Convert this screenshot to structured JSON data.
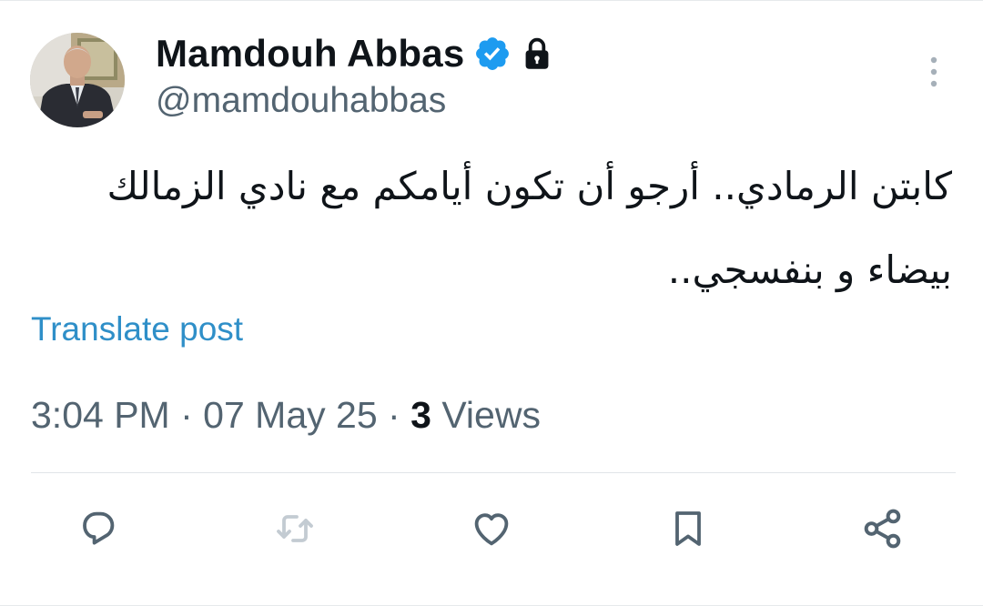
{
  "author": {
    "display_name": "Mamdouh Abbas",
    "handle": "@mamdouhabbas",
    "verified": true,
    "protected": true,
    "icons": {
      "verified": "verified-badge-icon",
      "protected": "lock-icon",
      "more": "more-vertical-icon"
    }
  },
  "post": {
    "text_line1": "كابتن الرمادي.. أرجو أن تكون أيامكم مع نادي الزمالك",
    "text_line2": "بيضاء و بنفسجي..",
    "translate_label": "Translate post",
    "time": "3:04 PM",
    "date": "07 May 25",
    "separator": "·",
    "views_count": "3",
    "views_label": "Views"
  },
  "actions": [
    {
      "name": "reply",
      "icon": "reply-icon"
    },
    {
      "name": "repost",
      "icon": "repost-icon"
    },
    {
      "name": "like",
      "icon": "heart-icon"
    },
    {
      "name": "bookmark",
      "icon": "bookmark-icon"
    },
    {
      "name": "share",
      "icon": "share-icon"
    }
  ],
  "colors": {
    "text": "#0f1419",
    "secondary": "#536471",
    "link": "#2f8fc8",
    "verified": "#1d9bf0",
    "divider": "#e1e5e8"
  }
}
